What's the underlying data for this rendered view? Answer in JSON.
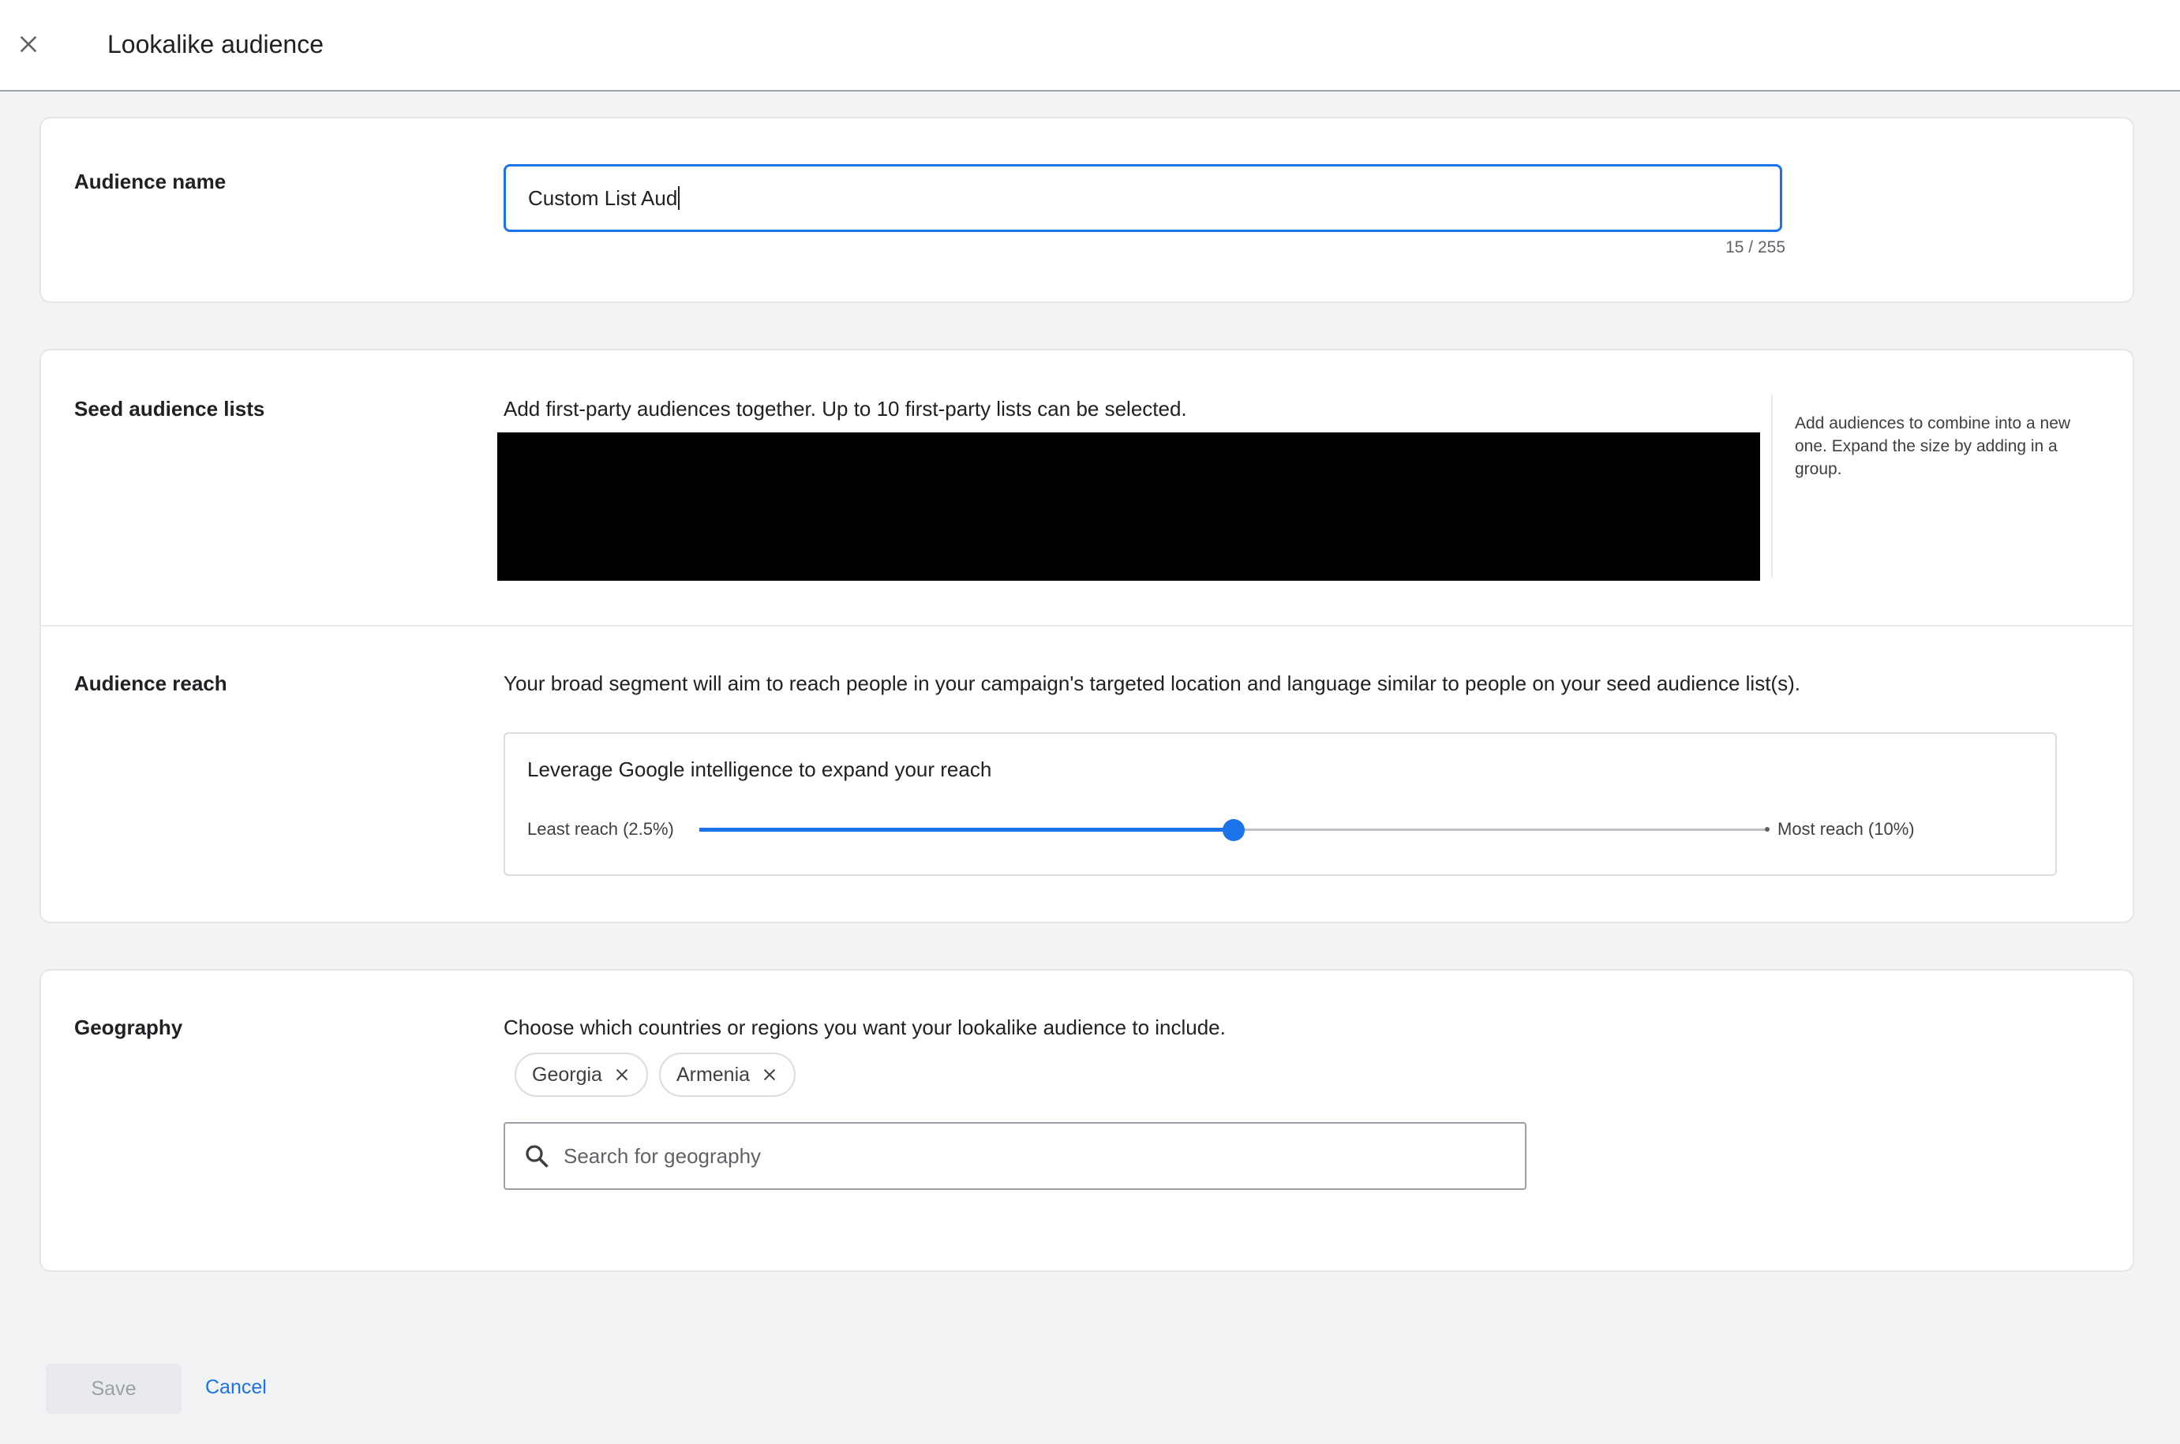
{
  "header": {
    "title": "Lookalike audience",
    "close_icon": "close-icon"
  },
  "audience_name": {
    "label": "Audience name",
    "value": "Custom List Aud",
    "char_count": "15 / 255"
  },
  "seed_lists": {
    "label": "Seed audience lists",
    "description": "Add first-party audiences together. Up to 10 first-party lists can be selected.",
    "side_help": "Add audiences to combine into a new one. Expand the size by adding in a group."
  },
  "audience_reach": {
    "label": "Audience reach",
    "description": "Your broad segment will aim to reach people in your campaign's targeted location and language similar to people on your seed audience list(s).",
    "box_title": "Leverage Google intelligence to expand your reach",
    "min_label": "Least reach (2.5%)",
    "max_label": "Most reach (10%)",
    "slider_value_fraction": 0.5
  },
  "geography": {
    "label": "Geography",
    "description": "Choose which countries or regions you want your lookalike audience to include.",
    "chips": [
      "Georgia",
      "Armenia"
    ],
    "search_placeholder": "Search for geography",
    "search_icon": "search-icon"
  },
  "footer": {
    "save_label": "Save",
    "cancel_label": "Cancel"
  },
  "colors": {
    "accent": "#1a73e8",
    "page_bg": "#f1f3f4"
  }
}
